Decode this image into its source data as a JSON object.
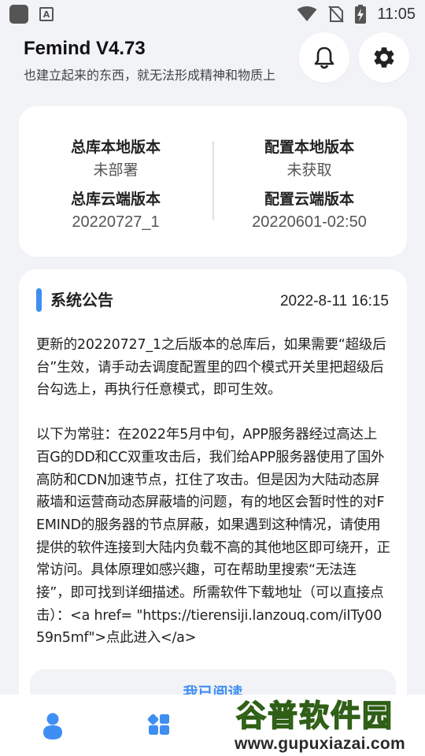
{
  "status_bar": {
    "time": "11:05",
    "icons": [
      "app-notification-icon",
      "a-icon",
      "wifi-icon",
      "no-sim-icon",
      "battery-charging-icon"
    ]
  },
  "header": {
    "title": "Femind V4.73",
    "subtitle": "也建立起来的东西，就无法形成精神和物质上",
    "icons": [
      "bell-icon",
      "gear-icon"
    ]
  },
  "versions": {
    "local_main_label": "总库本地版本",
    "local_main_value": "未部署",
    "cloud_main_label": "总库云端版本",
    "cloud_main_value": "20220727_1",
    "local_config_label": "配置本地版本",
    "local_config_value": "未获取",
    "cloud_config_label": "配置云端版本",
    "cloud_config_value": "20220601-02:50"
  },
  "notice": {
    "title": "系统公告",
    "time": "2022-8-11 16:15",
    "paragraph1": "更新的20220727_1之后版本的总库后，如果需要“超级后台”生效，请手动去调度配置里的四个模式开关里把超级后台勾选上，再执行任意模式，即可生效。",
    "paragraph2": "以下为常驻：在2022年5月中旬，APP服务器经过高达上百G的DD和CC双重攻击后，我们给APP服务器使用了国外高防和CDN加速节点，扛住了攻击。但是因为大陆动态屏蔽墙和运营商动态屏蔽墙的问题，有的地区会暂时性的对FEMIND的服务器的节点屏蔽，如果遇到这种情况，请使用提供的软件连接到大陆内负载不高的其他地区即可绕开，正常访问。具体原理如感兴趣，可在帮助里搜索“无法连接”，即可找到详细描述。所需软件下载地址（可以直接点击）：<a href= \"https://tierensiji.lanzouq.com/iITy0059n5mf\">点此进入</a>",
    "read_button": "我已阅读"
  },
  "bottom_nav": {
    "items": [
      "user-icon",
      "apps-icon"
    ]
  },
  "watermark": {
    "top": "谷普软件园",
    "bottom": "www.gupuxiazai.com"
  },
  "colors": {
    "accent": "#3f8ef3",
    "background": "#f1f3f6",
    "card": "#ffffff"
  }
}
